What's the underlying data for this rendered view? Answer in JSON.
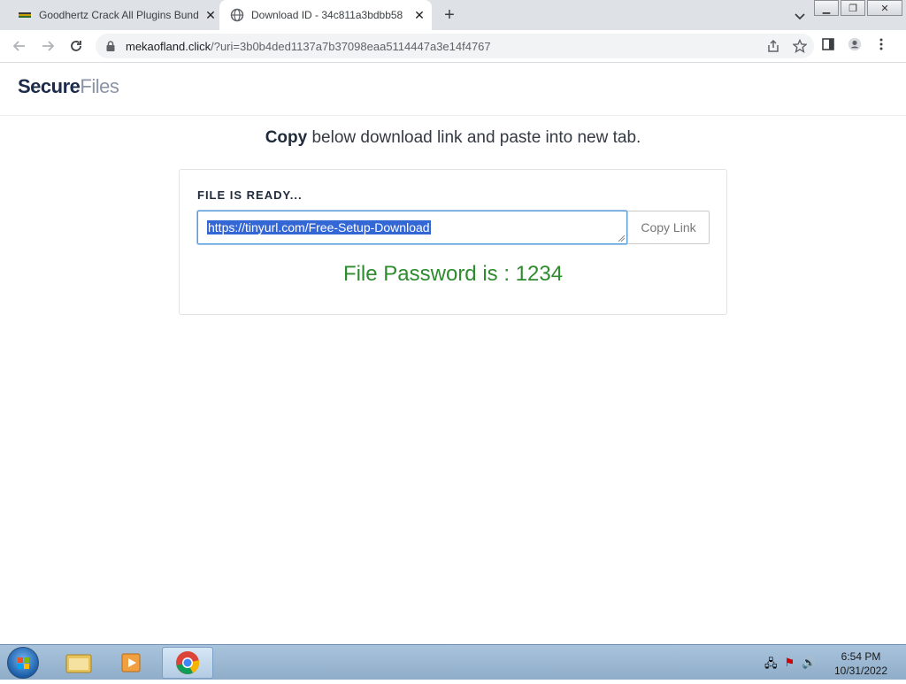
{
  "browser": {
    "tabs": [
      {
        "title": "Goodhertz Crack All Plugins Bundle",
        "favicon": "site-flag-favicon-icon",
        "active": false
      },
      {
        "title": "Download ID - 34c811a3bdbb58",
        "favicon": "globe-icon",
        "active": true
      }
    ],
    "url_host": "mekaofland.click",
    "url_path": "/?uri=3b0b4ded1137a7b37098eaa5114447a3e14f4767"
  },
  "site": {
    "logo_bold": "Secure",
    "logo_light": "Files",
    "instruction_bold": "Copy",
    "instruction_rest": " below download link and paste into new tab.",
    "ready_label": "FILE IS READY...",
    "link_value": "https://tinyurl.com/Free-Setup-Download",
    "copy_button": "Copy Link",
    "password_text": "File Password is : 1234"
  },
  "taskbar": {
    "time": "6:54 PM",
    "date": "10/31/2022"
  },
  "colors": {
    "password_green": "#2e8b2e",
    "selection_blue": "#3367d6",
    "logo_dark": "#1c2b4a",
    "logo_grey": "#8a94a6"
  }
}
